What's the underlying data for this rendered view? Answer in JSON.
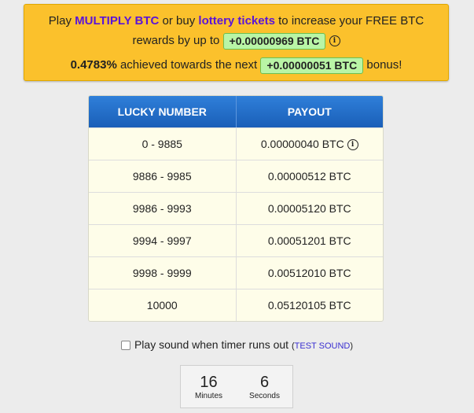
{
  "promo": {
    "play_text": "Play",
    "multiply_link": "MULTIPLY BTC",
    "or_buy_text": "or buy",
    "lottery_link": "lottery tickets",
    "increase_text": "to increase your FREE BTC",
    "rewards_text": "rewards by up to",
    "max_bonus": "+0.00000969 BTC",
    "achieved_percent": "0.4783%",
    "achieved_text": "achieved towards the next",
    "next_bonus": "+0.00000051 BTC",
    "bonus_text": "bonus!"
  },
  "table": {
    "headers": [
      "LUCKY NUMBER",
      "PAYOUT"
    ],
    "rows": [
      {
        "range": "0 - 9885",
        "payout": "0.00000040 BTC",
        "info": true
      },
      {
        "range": "9886 - 9985",
        "payout": "0.00000512 BTC"
      },
      {
        "range": "9986 - 9993",
        "payout": "0.00005120 BTC"
      },
      {
        "range": "9994 - 9997",
        "payout": "0.00051201 BTC"
      },
      {
        "range": "9998 - 9999",
        "payout": "0.00512010 BTC"
      },
      {
        "range": "10000",
        "payout": "0.05120105 BTC"
      }
    ]
  },
  "sound": {
    "label": "Play sound when timer runs out",
    "open_paren": "(",
    "test_link": "TEST SOUND",
    "close_paren": ")",
    "checked": false
  },
  "timer": {
    "minutes": "16",
    "minutes_label": "Minutes",
    "seconds": "6",
    "seconds_label": "Seconds"
  },
  "colors": {
    "promo_bg": "#fbc12c",
    "link_purple": "#5a14d8",
    "pill_green": "#b9f5a6",
    "header_blue": "#2f7fd9",
    "table_bg": "#fefde9"
  }
}
